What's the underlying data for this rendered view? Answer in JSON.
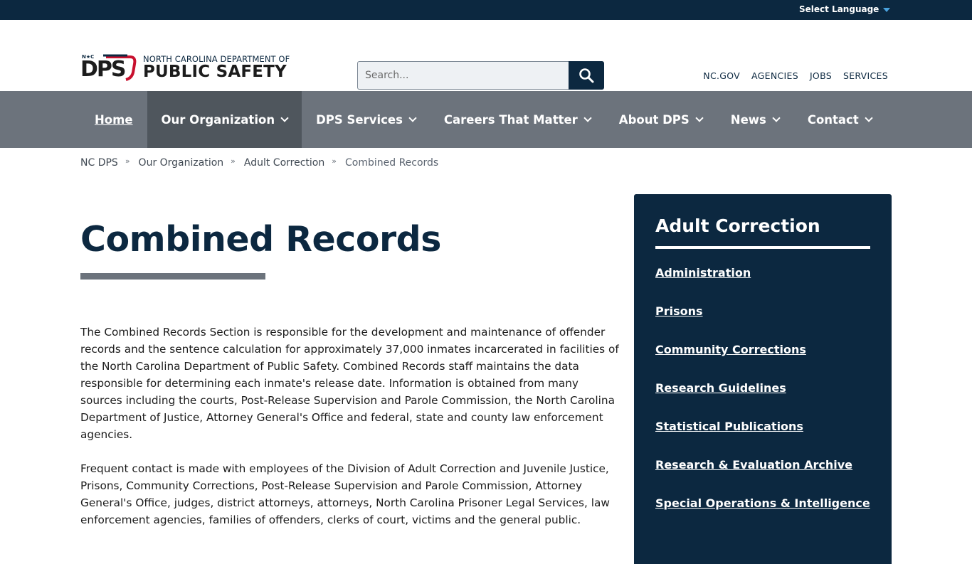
{
  "utility": {
    "language_label": "Select Language"
  },
  "header": {
    "logo": {
      "mark_text": "DPS",
      "mark_badge": "N★C",
      "line1": "NORTH CAROLINA DEPARTMENT OF",
      "line2": "PUBLIC SAFETY"
    },
    "search": {
      "placeholder": "Search..."
    },
    "util_links": [
      "NC.GOV",
      "AGENCIES",
      "JOBS",
      "SERVICES"
    ]
  },
  "nav": {
    "items": [
      {
        "label": "Home"
      },
      {
        "label": "Our Organization"
      },
      {
        "label": "DPS Services"
      },
      {
        "label": "Careers That Matter"
      },
      {
        "label": "About DPS"
      },
      {
        "label": "News"
      },
      {
        "label": "Contact"
      }
    ]
  },
  "breadcrumb": {
    "items": [
      "NC DPS",
      "Our Organization",
      "Adult Correction"
    ],
    "separator": "»",
    "current": "Combined Records"
  },
  "main": {
    "title": "Combined Records",
    "paragraphs": [
      "The Combined Records Section is responsible for the development and maintenance of offender records and the sentence calculation for approximately 37,000 inmates incarcerated in facilities of the North Carolina Department of Public Safety. Combined Records staff maintains the data responsible for determining each inmate's release date. Information is obtained from many sources including the courts, Post-Release Supervision and Parole Commission, the North Carolina Department of Justice, Attorney General's Office and federal, state and county law enforcement agencies.",
      "Frequent contact is made with employees of the Division of Adult Correction and Juvenile Justice, Prisons, Community Corrections, Post-Release Supervision and Parole Commission, Attorney General's Office, judges, district attorneys, attorneys, North Carolina Prisoner Legal Services, law enforcement agencies, families of offenders, clerks of court, victims and the general public."
    ]
  },
  "sidebar": {
    "title": "Adult Correction",
    "links": [
      "Administration",
      "Prisons",
      "Community Corrections",
      "Research Guidelines",
      "Statistical Publications",
      "Research & Evaluation Archive",
      "Special Operations & Intelligence"
    ]
  },
  "colors": {
    "navy": "#0c2840",
    "nav_gray": "#6c737c",
    "nav_active": "#4f565d"
  },
  "icons": {
    "search": "search-icon",
    "language_caret": "caret-down-icon",
    "nav_chevron": "chevron-down-icon"
  }
}
